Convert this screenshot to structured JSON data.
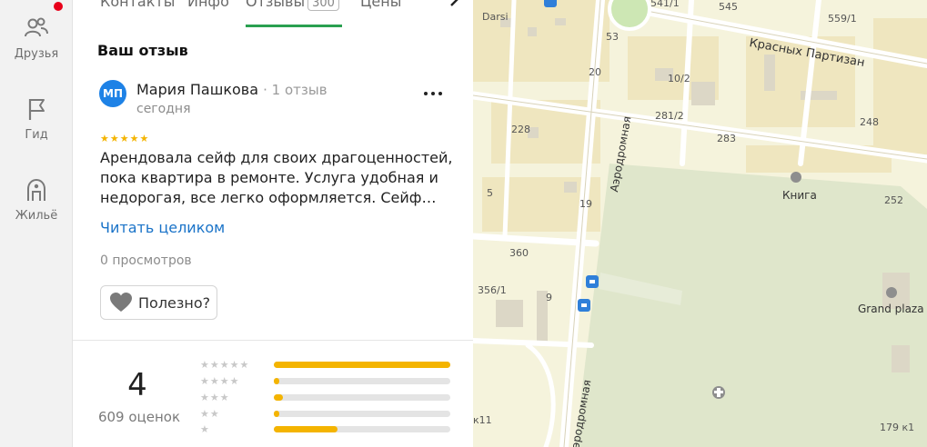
{
  "sidebar": {
    "items": [
      {
        "label": "Друзья",
        "icon": "friends-icon"
      },
      {
        "label": "Гид",
        "icon": "flag-icon"
      },
      {
        "label": "Жильё",
        "icon": "housing-icon"
      }
    ],
    "notification_color": "#e8001a"
  },
  "tabs": {
    "items": [
      {
        "label": "Контакты"
      },
      {
        "label": "Инфо"
      },
      {
        "label": "Отзывы",
        "count": "300",
        "active": true
      },
      {
        "label": "Цены"
      }
    ],
    "accent": "#2aa050"
  },
  "review": {
    "section_title": "Ваш отзыв",
    "avatar_initials": "МП",
    "avatar_color": "#1e82e6",
    "author": "Мария Пашкова",
    "author_reviews": "· 1 отзыв",
    "date": "сегодня",
    "stars": "★★★★★",
    "rating": 5,
    "text": "Арендовала сейф для своих драгоценностей, пока квартира в ремонте. Услуга удобная и недорогая, все легко оформляется. Сейф…",
    "read_more": "Читать целиком",
    "views": "0 просмотров",
    "helpful_label": "Полезно?"
  },
  "rating_summary": {
    "score": "4",
    "count_label": "609 оценок",
    "distribution": [
      {
        "stars": "★★★★★",
        "fraction": 1.0
      },
      {
        "stars": "★★★★",
        "fraction": 0.03
      },
      {
        "stars": "★★★",
        "fraction": 0.05
      },
      {
        "stars": "★★",
        "fraction": 0.03
      },
      {
        "stars": "★",
        "fraction": 0.36
      }
    ]
  },
  "map": {
    "labels": [
      {
        "text": "Darsi"
      },
      {
        "text": "541/1"
      },
      {
        "text": "545"
      },
      {
        "text": "559/1"
      },
      {
        "text": "53"
      },
      {
        "text": "Красных Партизан"
      },
      {
        "text": "20"
      },
      {
        "text": "10/2"
      },
      {
        "text": "281/2"
      },
      {
        "text": "248"
      },
      {
        "text": "228"
      },
      {
        "text": "283"
      },
      {
        "text": "Аэродромная"
      },
      {
        "text": "Книга"
      },
      {
        "text": "252"
      },
      {
        "text": "5"
      },
      {
        "text": "19"
      },
      {
        "text": "360"
      },
      {
        "text": "356/1"
      },
      {
        "text": "9"
      },
      {
        "text": "Grand plaza"
      },
      {
        "text": "Аэродромная"
      },
      {
        "text": "к11"
      },
      {
        "text": "179 к1"
      }
    ]
  }
}
